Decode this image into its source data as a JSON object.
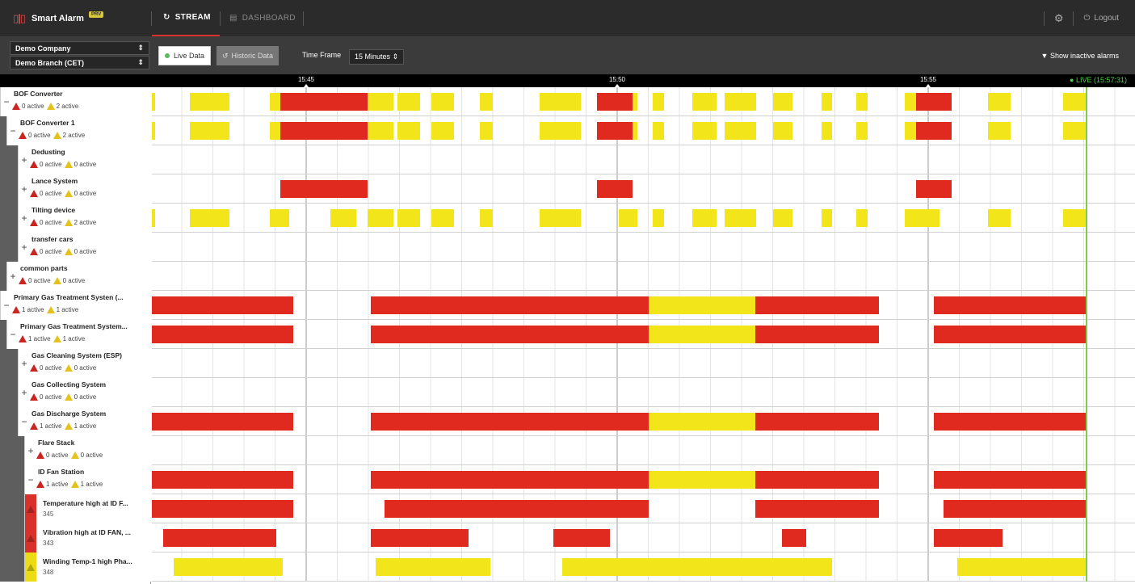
{
  "app": {
    "title": "Smart Alarm",
    "badge": "PRV"
  },
  "nav": {
    "tabs": [
      {
        "label": "STREAM",
        "icon": "refresh-icon"
      },
      {
        "label": "DASHBOARD",
        "icon": "dashboard-icon"
      }
    ],
    "logout_label": "Logout",
    "settings_icon": "gear-icon"
  },
  "filters": {
    "company": "Demo Company",
    "branch": "Demo Branch (CET)",
    "live_label": "Live Data",
    "historic_label": "Historic Data",
    "timeframe_label": "Time Frame",
    "timeframe_value": "15 Minutes",
    "inactive_label": "Show inactive alarms"
  },
  "timeline": {
    "ticks": [
      "15:45",
      "15:50",
      "15:55"
    ],
    "live": "LIVE (15:57:31)",
    "colors": {
      "critical": "#e02a1f",
      "warning": "#f2e51a",
      "live_line": "#7ccf4a"
    }
  },
  "rows": [
    {
      "type": "node",
      "level": 0,
      "toggle": "−",
      "name": "BOF Converter",
      "red": "0 active",
      "yellow": "2 active"
    },
    {
      "type": "node",
      "level": 1,
      "toggle": "−",
      "name": "BOF Converter 1",
      "red": "0 active",
      "yellow": "2 active"
    },
    {
      "type": "node",
      "level": 2,
      "toggle": "+",
      "name": "Dedusting",
      "red": "0 active",
      "yellow": "0 active"
    },
    {
      "type": "node",
      "level": 2,
      "toggle": "+",
      "name": "Lance System",
      "red": "0 active",
      "yellow": "0 active"
    },
    {
      "type": "node",
      "level": 2,
      "toggle": "+",
      "name": "Tilting device",
      "red": "0 active",
      "yellow": "2 active"
    },
    {
      "type": "node",
      "level": 2,
      "toggle": "+",
      "name": "transfer cars",
      "red": "0 active",
      "yellow": "0 active"
    },
    {
      "type": "node",
      "level": 1,
      "toggle": "+",
      "name": "common parts",
      "red": "0 active",
      "yellow": "0 active"
    },
    {
      "type": "node",
      "level": 0,
      "toggle": "−",
      "name": "Primary Gas Treatment Systen (...",
      "red": "1 active",
      "yellow": "1 active"
    },
    {
      "type": "node",
      "level": 1,
      "toggle": "−",
      "name": "Primary Gas Treatment System...",
      "red": "1 active",
      "yellow": "1 active"
    },
    {
      "type": "node",
      "level": 2,
      "toggle": "+",
      "name": "Gas Cleaning System (ESP)",
      "red": "0 active",
      "yellow": "0 active"
    },
    {
      "type": "node",
      "level": 2,
      "toggle": "+",
      "name": "Gas Collecting System",
      "red": "0 active",
      "yellow": "0 active"
    },
    {
      "type": "node",
      "level": 2,
      "toggle": "−",
      "name": "Gas Discharge System",
      "red": "1 active",
      "yellow": "1 active"
    },
    {
      "type": "node",
      "level": 3,
      "toggle": "+",
      "name": "Flare Stack",
      "red": "0 active",
      "yellow": "0 active"
    },
    {
      "type": "node",
      "level": 3,
      "toggle": "−",
      "name": "ID Fan Station",
      "red": "1 active",
      "yellow": "1 active"
    },
    {
      "type": "alarm",
      "level": 3,
      "severity": "red",
      "name": "Temperature high at ID F...",
      "code": "345"
    },
    {
      "type": "alarm",
      "level": 3,
      "severity": "red",
      "name": "Vibration high at ID FAN, ...",
      "code": "343"
    },
    {
      "type": "alarm",
      "level": 3,
      "severity": "yellow",
      "name": "Winding Temp-1 high Pha...",
      "code": "348"
    }
  ]
}
